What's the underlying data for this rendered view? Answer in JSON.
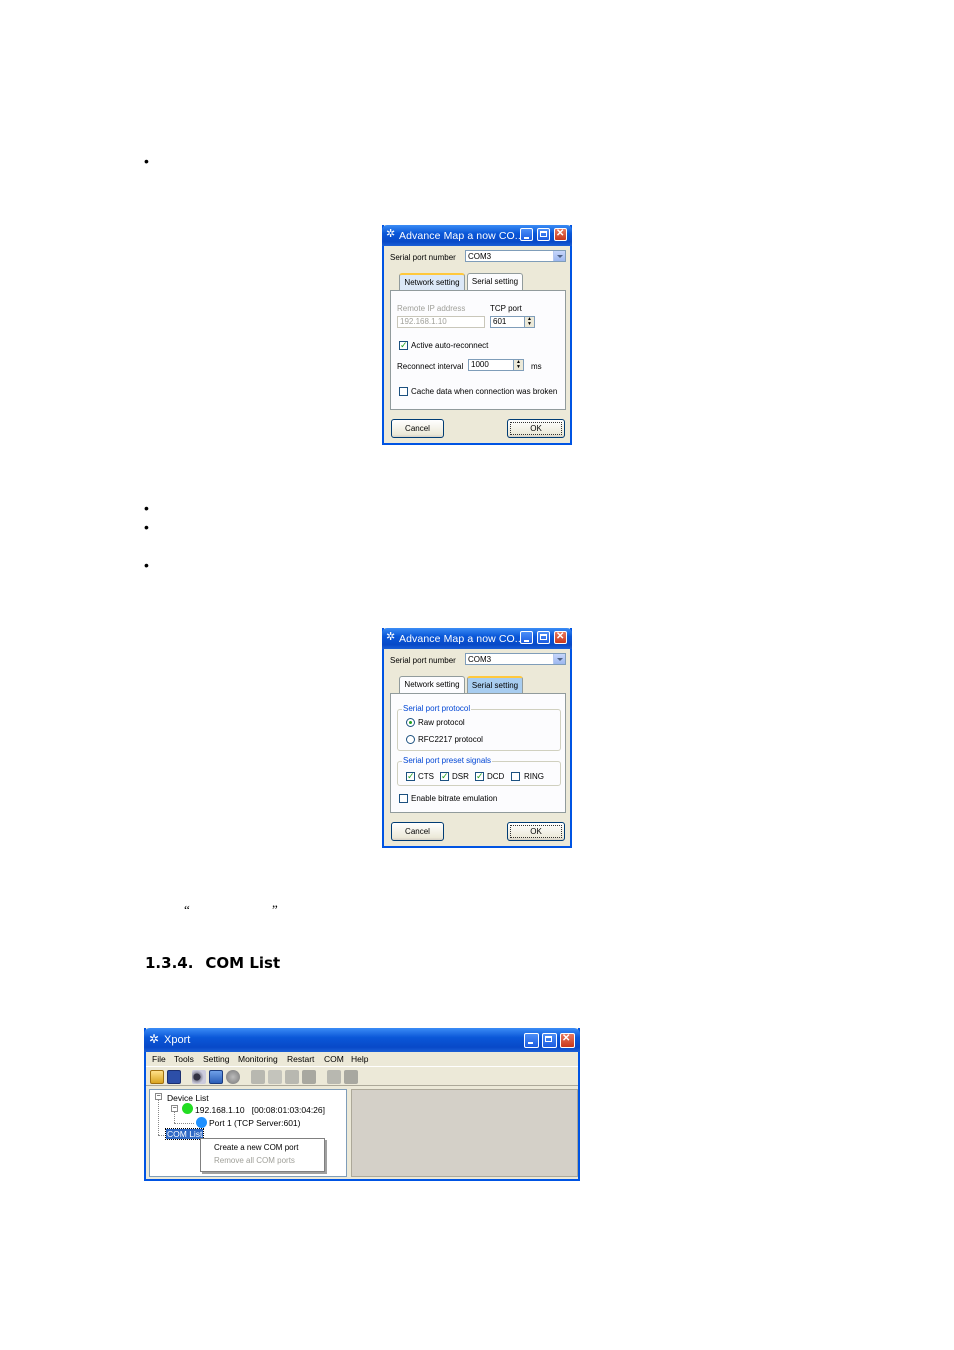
{
  "section": {
    "heading_number": "1.3.4.",
    "heading_title": "COM List",
    "quote_open": "“",
    "quote_close": "”"
  },
  "bullets": [
    "•",
    "•",
    "•",
    "•"
  ],
  "dialog1": {
    "title": "Advance Map a now CO...",
    "serial_port_label": "Serial port number",
    "serial_port_value": "COM3",
    "tab_network": "Network setting",
    "tab_serial": "Serial setting",
    "remote_ip_label": "Remote IP address",
    "remote_ip_value": "192.168.1.10",
    "tcp_port_label": "TCP port",
    "tcp_port_value": "601",
    "auto_reconnect_label": "Active auto-reconnect",
    "auto_reconnect_checked": true,
    "reconnect_interval_label": "Reconnect interval",
    "reconnect_interval_value": "1000",
    "reconnect_unit": "ms",
    "cache_label": "Cache data when connection was broken",
    "cache_checked": false,
    "cancel_label": "Cancel",
    "ok_label": "OK"
  },
  "dialog2": {
    "title": "Advance Map a now CO...",
    "serial_port_label": "Serial port number",
    "serial_port_value": "COM3",
    "tab_network": "Network setting",
    "tab_serial": "Serial setting",
    "protocol_group": "Serial port protocol",
    "raw_protocol": "Raw protocol",
    "rfc_protocol": "RFC2217 protocol",
    "preset_group": "Serial port preset signals",
    "cts": "CTS",
    "dsr": "DSR",
    "dcd": "DCD",
    "ring": "RING",
    "bitrate_label": "Enable bitrate emulation",
    "cancel_label": "Cancel",
    "ok_label": "OK"
  },
  "xport": {
    "title": "Xport",
    "menu": [
      "File",
      "Tools",
      "Setting",
      "Monitoring",
      "Restart",
      "COM",
      "Help"
    ],
    "tree": {
      "device_list": "Device List",
      "device": "192.168.1.10",
      "mac": "[00:08:01:03:04:26]",
      "port": "Port 1   (TCP Server:601)",
      "com_list": "COM List"
    },
    "context_menu": {
      "create": "Create a new COM port",
      "remove": "Remove all COM ports"
    },
    "colors": {
      "device_status": "#22dd22",
      "port_status": "#1e90ff"
    }
  }
}
